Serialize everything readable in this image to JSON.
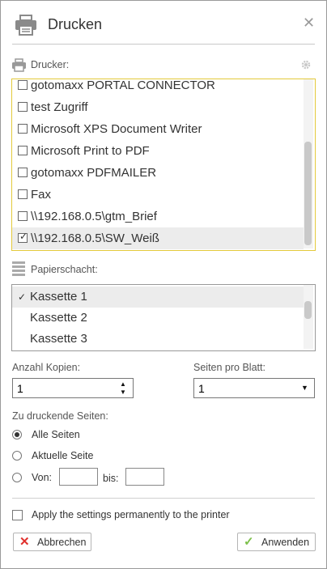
{
  "dialog": {
    "title": "Drucken",
    "close_icon": "close-icon",
    "header_icon": "printer-icon"
  },
  "printer_section": {
    "label": "Drucker:",
    "icon": "printer-icon",
    "settings_icon": "gear-icon",
    "items": [
      {
        "label": "gotomaxx PORTAL CONNECTOR",
        "checked": false
      },
      {
        "label": "test Zugriff",
        "checked": false
      },
      {
        "label": "Microsoft XPS Document Writer",
        "checked": false
      },
      {
        "label": "Microsoft Print to PDF",
        "checked": false
      },
      {
        "label": "gotomaxx PDFMAILER",
        "checked": false
      },
      {
        "label": "Fax",
        "checked": false
      },
      {
        "label": "\\\\192.168.0.5\\gtm_Brief",
        "checked": false
      },
      {
        "label": "\\\\192.168.0.5\\SW_Weiß",
        "checked": true
      }
    ]
  },
  "tray_section": {
    "label": "Papierschacht:",
    "icon": "paper-stack-icon",
    "items": [
      {
        "label": "Kassette 1",
        "selected": true
      },
      {
        "label": "Kassette 2",
        "selected": false
      },
      {
        "label": "Kassette 3",
        "selected": false
      }
    ]
  },
  "copies": {
    "label": "Anzahl Kopien:",
    "value": "1"
  },
  "pages_per_sheet": {
    "label": "Seiten pro Blatt:",
    "value": "1"
  },
  "pages_to_print": {
    "label": "Zu druckende Seiten:",
    "options": [
      {
        "label": "Alle Seiten",
        "selected": true
      },
      {
        "label": "Aktuelle Seite",
        "selected": false
      },
      {
        "label": "Von:",
        "selected": false
      }
    ],
    "from_value": "",
    "to_label": "bis:",
    "to_value": ""
  },
  "apply_permanently": {
    "label": "Apply the settings permanently to the printer",
    "checked": false
  },
  "buttons": {
    "cancel": {
      "label": "Abbrechen",
      "icon": "x-icon",
      "color": "#e0302d"
    },
    "apply": {
      "label": "Anwenden",
      "icon": "check-icon",
      "color": "#7cc04a"
    }
  },
  "colors": {
    "printer_list_border": "#e3c93b",
    "selected_row": "#ececec"
  }
}
